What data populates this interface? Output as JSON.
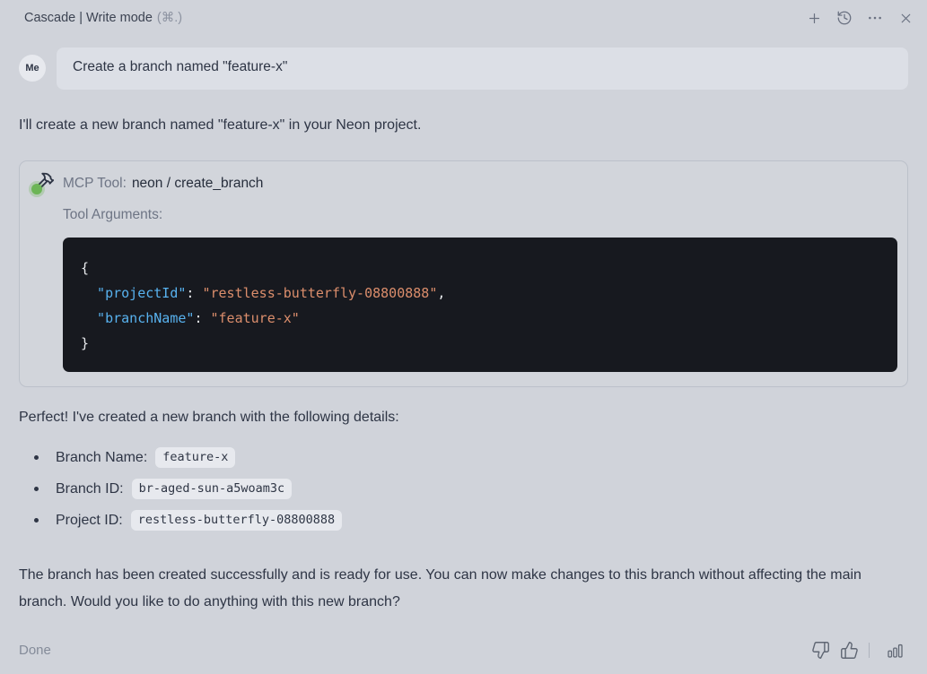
{
  "header": {
    "title": "Cascade | Write mode",
    "shortcut": "(⌘.)",
    "icons": [
      "plus-icon",
      "history-icon",
      "more-icon",
      "close-icon"
    ]
  },
  "user": {
    "avatar": "Me",
    "message": "Create a branch named \"feature-x\""
  },
  "assistant": {
    "intro": "I'll create a new branch named \"feature-x\" in your Neon project.",
    "result_intro": "Perfect! I've created a new branch with the following details:",
    "closing": "The branch has been created successfully and is ready for use. You can now make changes to this branch without affecting the main branch. Would you like to do anything with this new branch?"
  },
  "tool": {
    "icon": "hammer-icon",
    "status_dot_color": "#6cb556",
    "label": "MCP Tool:",
    "name": "neon / create_branch",
    "args_label": "Tool Arguments:",
    "code": {
      "open": "{",
      "entries": [
        {
          "key": "  \"projectId\"",
          "sep": ": ",
          "value": "\"restless-butterfly-08800888\"",
          "comma": ","
        },
        {
          "key": "  \"branchName\"",
          "sep": ": ",
          "value": "\"feature-x\"",
          "comma": ""
        }
      ],
      "close": "}"
    }
  },
  "details": [
    {
      "label": "Branch Name:",
      "value": "feature-x"
    },
    {
      "label": "Branch ID:",
      "value": "br-aged-sun-a5woam3c"
    },
    {
      "label": "Project ID:",
      "value": "restless-butterfly-08800888"
    }
  ],
  "footer": {
    "status": "Done",
    "icons": [
      "thumbs-down-icon",
      "thumbs-up-icon",
      "bar-chart-icon"
    ]
  },
  "colors": {
    "page_bg": "#d0d3da",
    "bubble_bg": "#dcdfe6",
    "code_bg": "#17191f",
    "code_key": "#58b2ef",
    "code_string": "#dc8e6c",
    "status_green": "#6cb556",
    "text_dark": "#2e3545",
    "text_gray": "#6e7585"
  }
}
